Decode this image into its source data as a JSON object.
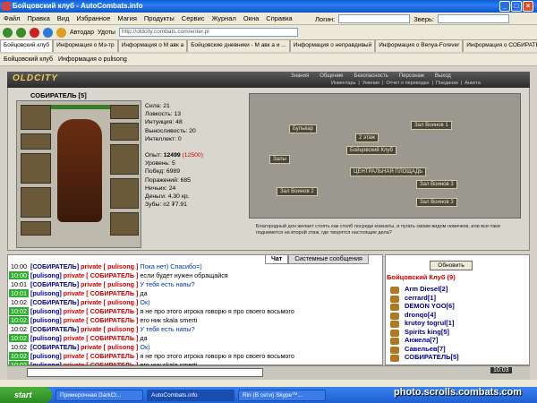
{
  "window": {
    "title": "Бойцовский клуб - AutoCombats.info"
  },
  "menu": [
    "Файл",
    "Правка",
    "Вид",
    "Избранное",
    "Магия",
    "Продукты",
    "Сервис",
    "Журнал",
    "Окна",
    "Справка"
  ],
  "login_label": "Логин:",
  "beast_label": "Зверь:",
  "toolbar": {
    "autodar": "Автодар",
    "udoty": "Удоты",
    "url": "http://oldcity.combats.com/enter.pl"
  },
  "tabs": [
    "Бойцовский клуб",
    "Информация о Мэ-тр",
    "Информация о М авк а",
    "Бойцовские дневники - М авк а и ...",
    "Информация о неправдивый",
    "Информация о Benya-Forever",
    "Информация о СОБИРАТЕЛЬ"
  ],
  "subtabs": [
    "Бойцовский клуб",
    "Информация о pulisong"
  ],
  "game": {
    "logo": "OLDCITY",
    "nav": [
      "Знания",
      "Общение",
      "Безопасность",
      "Персонаж",
      "Выход"
    ],
    "subnav": [
      "Инвентарь",
      "Умения",
      "Отчет о переводах",
      "Поединки",
      "Анкета"
    ]
  },
  "character": {
    "name": "СОБИРАТЕЛЬ [5]",
    "stats": [
      "Сила: 21",
      "Ловкость: 13",
      "Интуиция: 48",
      "Выносливость: 20",
      "Интеллект: 0"
    ],
    "exp_label": "Опыт:",
    "exp": "12499",
    "exp_next": "(12500)",
    "info": [
      "Уровень: 5",
      "Побед: 6989",
      "Поражений: 685",
      "Ничьих: 24",
      "Деньги: 4.30 кр.",
      "Зубы: ¤2 ₮7.91"
    ]
  },
  "map": {
    "labels": [
      "Бульвар",
      "Зал Воинов 1",
      "2 этаж",
      "Бойцовский Клуб",
      "Залы",
      "ЦЕНТРАЛЬНАЯ ПЛОЩАДЬ",
      "Зал Воинов 2",
      "Зал Воинов 3",
      "Зал Воинов 3"
    ],
    "description": "Благородный дон желает стоять как столб посреди комнаты, и пугать своим видом новичков, или все-таки поднимется на второй этаж, где творятся настоящие дела?"
  },
  "chat_tabs": [
    "Чат",
    "Системные сообщения"
  ],
  "chat": [
    {
      "time": "10:00",
      "hl": false,
      "who": "[СОБИРАТЕЛЬ]",
      "mid": " private [ pulisong ] ",
      "text": "Пока нет) Спасибо=)",
      "blue": true
    },
    {
      "time": "10:00",
      "hl": true,
      "who": "[pulisong]",
      "mid": " private [ СОБИРАТЕЛЬ ] ",
      "text": "если будет нужен обращайся",
      "blue": false
    },
    {
      "time": "10:01",
      "hl": false,
      "who": "[СОБИРАТЕЛЬ]",
      "mid": " private [ pulisong ] ",
      "text": "У тебя есть напы?",
      "blue": true
    },
    {
      "time": "10:01",
      "hl": true,
      "who": "[pulisong]",
      "mid": " private [ СОБИРАТЕЛЬ ] ",
      "text": "да",
      "blue": false
    },
    {
      "time": "10:02",
      "hl": false,
      "who": "[СОБИРАТЕЛЬ]",
      "mid": " private [ pulisong ] ",
      "text": "Ок)",
      "blue": true
    },
    {
      "time": "10:02",
      "hl": true,
      "who": "[pulisong]",
      "mid": " private [ СОБИРАТЕЛЬ ] ",
      "text": "я не про этого игрока говорю я про своего восьмого",
      "blue": false
    },
    {
      "time": "10:02",
      "hl": true,
      "who": "[pulisong]",
      "mid": " private [ СОБИРАТЕЛЬ ] ",
      "text": "его ник skala smerti",
      "blue": false
    },
    {
      "time": "10:02",
      "hl": false,
      "who": "[СОБИРАТЕЛЬ]",
      "mid": " private [ pulisong ] ",
      "text": "У тебя есть напы?",
      "blue": true
    },
    {
      "time": "10:02",
      "hl": true,
      "who": "[pulisong]",
      "mid": " private [ СОБИРАТЕЛЬ ] ",
      "text": "да",
      "blue": false
    },
    {
      "time": "10:02",
      "hl": false,
      "who": "[СОБИРАТЕЛЬ]",
      "mid": " private [ pulisong ] ",
      "text": "Ок)",
      "blue": true
    },
    {
      "time": "10:02",
      "hl": true,
      "who": "[pulisong]",
      "mid": " private [ СОБИРАТЕЛЬ ] ",
      "text": "я не про этого игрока говорю я про своего восьмого",
      "blue": false
    },
    {
      "time": "10:02",
      "hl": true,
      "who": "[pulisong]",
      "mid": " private [ СОБИРАТЕЛЬ ] ",
      "text": "его ник skala smerti",
      "blue": false
    }
  ],
  "online": {
    "refresh": "Обновить",
    "room": "Бойцовский Клуб (9)",
    "users": [
      "Arm Diesel[2]",
      "cerrard[1]",
      "DEMON YOO[6]",
      "dronqo[4]",
      "krutoy togrul[1]",
      "Spirits king[5]",
      "Анжела[7]",
      "Савельев[7]",
      "СОБИРАТЕЛЬ[5]"
    ]
  },
  "clock": "10:03",
  "taskbar": {
    "start": "start",
    "tasks": [
      "Примерочная DarkCl...",
      "AutoCombats.info",
      "Rin (В сети) Skype™..."
    ]
  },
  "watermark": "photo.scrolls.combats.com"
}
